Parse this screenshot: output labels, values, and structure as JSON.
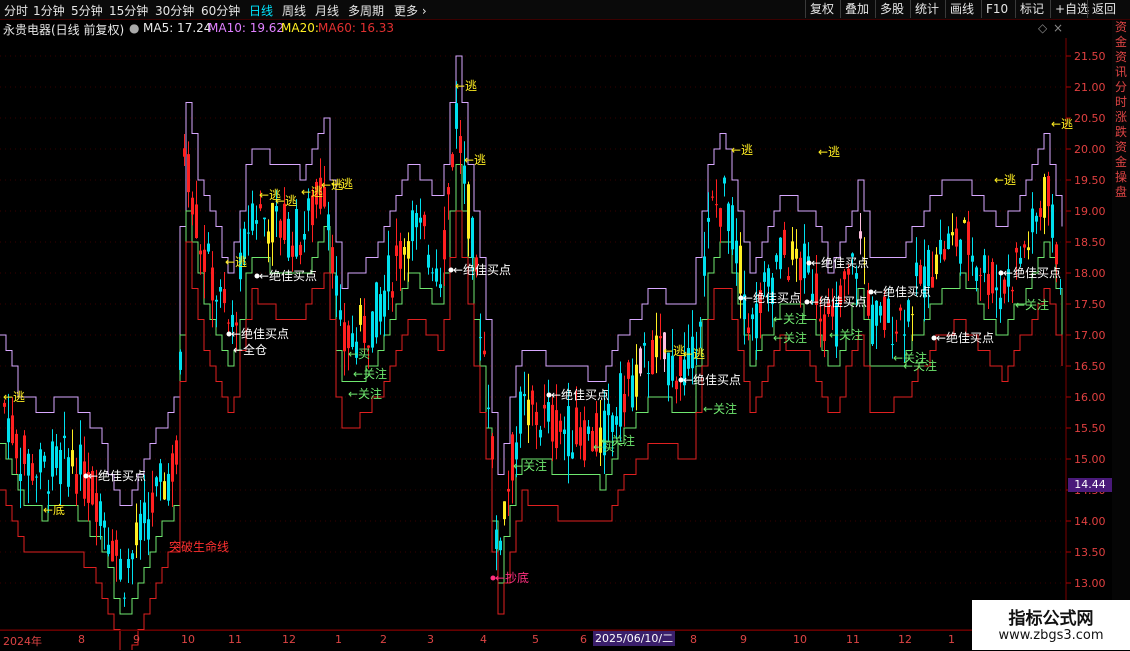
{
  "toolbar": {
    "periods": [
      {
        "label": "分时",
        "active": false
      },
      {
        "label": "1分钟",
        "active": false
      },
      {
        "label": "5分钟",
        "active": false
      },
      {
        "label": "15分钟",
        "active": false
      },
      {
        "label": "30分钟",
        "active": false
      },
      {
        "label": "60分钟",
        "active": false
      },
      {
        "label": "日线",
        "active": true
      },
      {
        "label": "周线",
        "active": false
      },
      {
        "label": "月线",
        "active": false
      },
      {
        "label": "多周期",
        "active": false
      },
      {
        "label": "更多 ›",
        "active": false
      }
    ],
    "right_buttons": [
      "复权",
      "叠加",
      "多股",
      "统计",
      "画线",
      "F10",
      "标记",
      "+自选",
      "返回"
    ]
  },
  "info": {
    "stock": "永贵电器(日线 前复权)",
    "ma5": "MA5: 17.24",
    "ma10": "MA10: 19.62",
    "ma20": "MA20:",
    "ma60": "MA60: 16.33"
  },
  "colors": {
    "up": "#ff2020",
    "down": "#00e0ee",
    "yellow": "#ffee22",
    "pink": "#ffc0e0",
    "ma_purple": "#d8a8ff",
    "green_line": "#6fe86f",
    "red_line": "#e02020"
  },
  "price_axis": {
    "ticks": [
      "21.50",
      "21.00",
      "20.50",
      "20.00",
      "19.50",
      "19.00",
      "18.50",
      "18.00",
      "17.50",
      "17.00",
      "16.50",
      "16.00",
      "15.50",
      "15.00",
      "14.50",
      "14.00",
      "13.50",
      "13.00"
    ],
    "current_price": "14.44"
  },
  "date_axis": {
    "labels": [
      "2024年",
      "8",
      "9",
      "10",
      "11",
      "12",
      "1",
      "2",
      "3",
      "4",
      "5",
      "6",
      "8",
      "9",
      "10",
      "11",
      "12",
      "1"
    ],
    "selected": "2025/06/10/二"
  },
  "signals": [
    {
      "text": "←逃",
      "color": "#ffee22"
    },
    {
      "text": "←绝佳买点",
      "color": "#ffffff"
    },
    {
      "text": "←底",
      "color": "#ffee22"
    },
    {
      "text": "突破生命线",
      "color": "#ff3030"
    },
    {
      "text": "←逃",
      "color": "#ffee22"
    },
    {
      "text": "←绝佳买点",
      "color": "#ffffff"
    },
    {
      "text": "←绝佳买点",
      "color": "#ffffff"
    },
    {
      "text": "←逃",
      "color": "#ffee22"
    },
    {
      "text": "←逃",
      "color": "#ffee22"
    },
    {
      "text": "←逃",
      "color": "#ffee22"
    },
    {
      "text": "←逃",
      "color": "#ffee22"
    },
    {
      "text": "←逃",
      "color": "#ffee22"
    },
    {
      "text": "←全仓",
      "color": "#ffffff"
    },
    {
      "text": "←买",
      "color": "#6fe86f"
    },
    {
      "text": "←关注",
      "color": "#6fe86f"
    },
    {
      "text": "←关注",
      "color": "#6fe86f"
    },
    {
      "text": "←逃",
      "color": "#ffee22"
    },
    {
      "text": "←逃",
      "color": "#ffee22"
    },
    {
      "text": "←绝佳买点",
      "color": "#ffffff"
    },
    {
      "text": "←抄底",
      "color": "#ff3080"
    },
    {
      "text": "←关注",
      "color": "#6fe86f"
    },
    {
      "text": "←绝佳买点",
      "color": "#ffffff"
    },
    {
      "text": "←买",
      "color": "#6fe86f"
    },
    {
      "text": "←关注",
      "color": "#6fe86f"
    },
    {
      "text": "←逃",
      "color": "#ffee22"
    },
    {
      "text": "←逃",
      "color": "#ffee22"
    },
    {
      "text": "←绝佳买点",
      "color": "#ffffff"
    },
    {
      "text": "←关注",
      "color": "#6fe86f"
    },
    {
      "text": "←逃",
      "color": "#ffee22"
    },
    {
      "text": "←绝佳买点",
      "color": "#ffffff"
    },
    {
      "text": "←关注",
      "color": "#6fe86f"
    },
    {
      "text": "←关注",
      "color": "#6fe86f"
    },
    {
      "text": "←逃",
      "color": "#ffee22"
    },
    {
      "text": "←绝佳买点",
      "color": "#ffffff"
    },
    {
      "text": "←绝佳买点",
      "color": "#ffffff"
    },
    {
      "text": "←关注",
      "color": "#6fe86f"
    },
    {
      "text": "←关注",
      "color": "#6fe86f"
    },
    {
      "text": "←逃",
      "color": "#ffee22"
    },
    {
      "text": "←绝佳买点",
      "color": "#ffffff"
    },
    {
      "text": "←绝佳买点",
      "color": "#ffffff"
    },
    {
      "text": "←关注",
      "color": "#6fe86f"
    },
    {
      "text": "←逃",
      "color": "#ffee22"
    },
    {
      "text": "←绝佳买点",
      "color": "#ffffff"
    },
    {
      "text": "←关注",
      "color": "#6fe86f"
    }
  ],
  "right_panel": [
    "资",
    "金",
    "资",
    "讯",
    "分",
    "时",
    "涨",
    "跌",
    "资",
    "金",
    "操",
    "盘"
  ],
  "watermark": {
    "line1": "指标公式网",
    "line2": "www.zbgs3.com"
  }
}
